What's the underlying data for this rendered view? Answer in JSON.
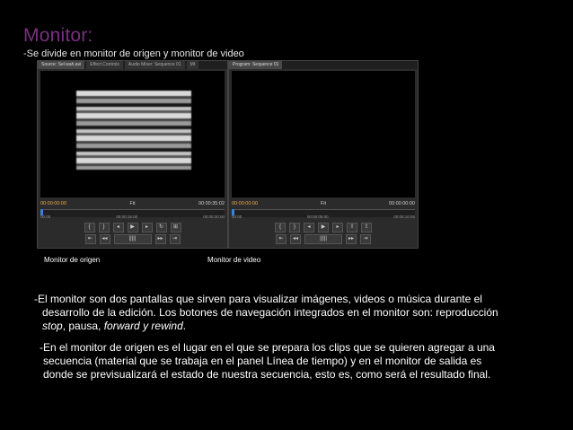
{
  "title": "Monitor:",
  "subtitle": "-Se divide en monitor de origen y monitor de video",
  "source_panel": {
    "tabs": [
      "Source: Sel.wah.avi",
      "Effect Controls",
      "Audio Mixer: Sequence 01",
      "Mt"
    ],
    "timecode_in": "00:00:00:00",
    "fit": "Fit",
    "timecode_out": "00:00:35:02",
    "ruler": [
      "00:00",
      "00:00:15:00",
      "00:00:30:00"
    ]
  },
  "program_panel": {
    "tabs": [
      "Program: Sequence 01"
    ],
    "timecode_in": "00:00:00:00",
    "fit": "Fit",
    "timecode_out": "00:00:00:00",
    "ruler": [
      "00:00",
      "00:00:05:00",
      "00:00:10:00"
    ]
  },
  "captions": {
    "source": "Monitor de origen",
    "video": "Monitor de video"
  },
  "paragraph1": {
    "line1": "-El monitor son dos pantallas que sirven para visualizar imágenes, videos o música durante el",
    "line2": "desarrollo de la edición. Los botones de navegación integrados en el monitor son: reproducción",
    "stop": "stop",
    "comma1": ", pausa, ",
    "forward": "forward y rewind",
    "period": "."
  },
  "paragraph2": {
    "line1": "-En el monitor de origen es el lugar en el que se prepara los clips que se quieren agregar a una",
    "line2": "secuencia (material que se trabaja en el panel Línea de tiempo) y en el monitor de salida es",
    "line3": "donde se previsualizará el estado de nuestra secuencia, esto es, como será el resultado final."
  },
  "colors": {
    "title": "#7a2f82",
    "timecode": "#e9a84a",
    "playhead": "#3b7fd6"
  }
}
